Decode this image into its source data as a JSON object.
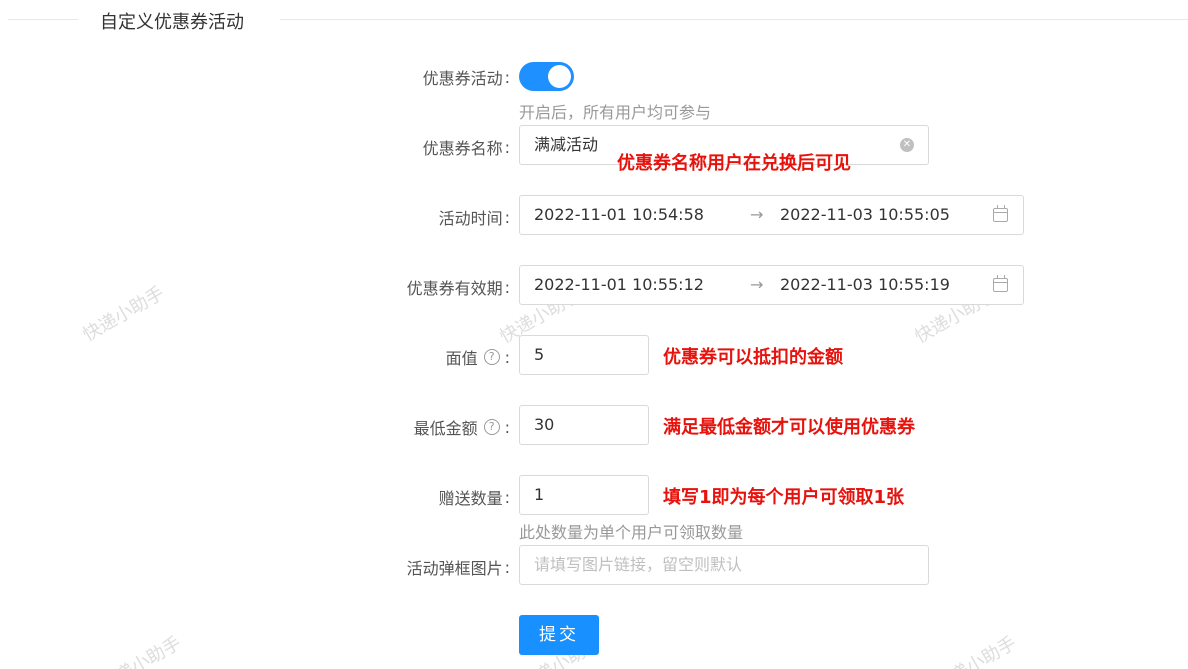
{
  "section": {
    "title": "自定义优惠券活动"
  },
  "form": {
    "switch": {
      "label": "优惠券活动",
      "on": true,
      "hint": "开启后，所有用户均可参与"
    },
    "name": {
      "label": "优惠券名称",
      "value": "满减活动",
      "annotation": "优惠券名称用户在兑换后可见"
    },
    "activity_time": {
      "label": "活动时间",
      "start": "2022-11-01 10:54:58",
      "arrow": "→",
      "end": "2022-11-03 10:55:05"
    },
    "validity": {
      "label": "优惠券有效期",
      "start": "2022-11-01 10:55:12",
      "arrow": "→",
      "end": "2022-11-03 10:55:19"
    },
    "face_value": {
      "label": "面值",
      "help": "?",
      "value": "5",
      "annotation": "优惠券可以抵扣的金额"
    },
    "min_amount": {
      "label": "最低金额",
      "help": "?",
      "value": "30",
      "annotation": "满足最低金额才可以使用优惠券"
    },
    "gift_count": {
      "label": "赠送数量",
      "value": "1",
      "annotation": "填写1即为每个用户可领取1张",
      "hint": "此处数量为单个用户可领取数量"
    },
    "popup_image": {
      "label": "活动弹框图片",
      "placeholder": "请填写图片链接，留空则默认"
    },
    "colon": ":",
    "submit_label": "提交"
  },
  "watermark_text": "快递小助手",
  "colors": {
    "primary": "#1890ff",
    "annotation": "#e8120c",
    "hint": "#999999"
  }
}
